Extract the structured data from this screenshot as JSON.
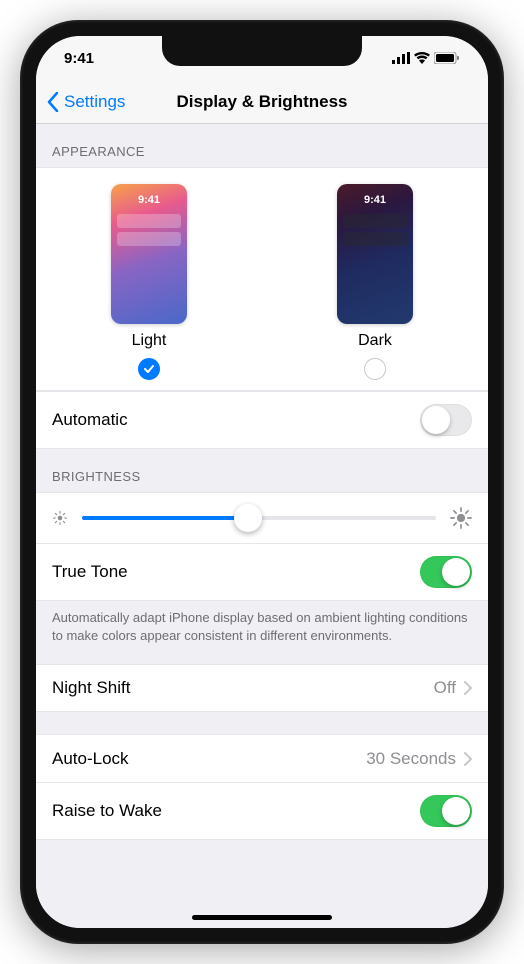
{
  "status": {
    "time": "9:41"
  },
  "nav": {
    "back": "Settings",
    "title": "Display & Brightness"
  },
  "appearance": {
    "header": "APPEARANCE",
    "preview_time": "9:41",
    "light_label": "Light",
    "dark_label": "Dark",
    "selected": "light",
    "automatic_label": "Automatic",
    "automatic_on": false
  },
  "brightness": {
    "header": "BRIGHTNESS",
    "value_pct": 47,
    "truetone_label": "True Tone",
    "truetone_on": true,
    "truetone_note": "Automatically adapt iPhone display based on ambient lighting conditions to make colors appear consistent in different environments."
  },
  "nightshift": {
    "label": "Night Shift",
    "value": "Off"
  },
  "autolock": {
    "label": "Auto-Lock",
    "value": "30 Seconds"
  },
  "raise_to_wake": {
    "label": "Raise to Wake",
    "on": true
  }
}
